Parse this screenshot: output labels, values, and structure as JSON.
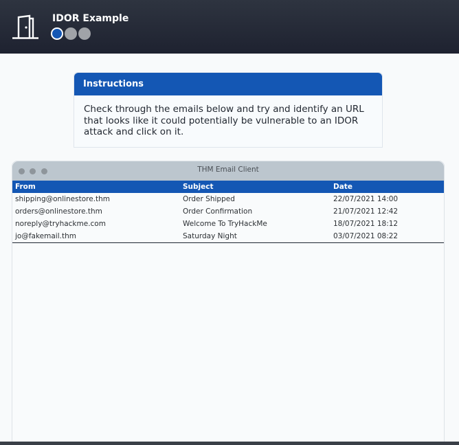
{
  "app": {
    "title": "IDOR Example",
    "icon": "door-icon",
    "steps": [
      {
        "state": "active"
      },
      {
        "state": "inactive"
      },
      {
        "state": "inactive"
      }
    ]
  },
  "instructions": {
    "heading": "Instructions",
    "body": "Check through the emails below and try and identify an URL that looks like it could potentially be vulnerable to an IDOR attack and click on it."
  },
  "email_client": {
    "title": "THM Email Client",
    "columns": [
      "From",
      "Subject",
      "Date"
    ],
    "emails": [
      {
        "from": "shipping@onlinestore.thm",
        "subject": "Order Shipped",
        "date": "22/07/2021 14:00"
      },
      {
        "from": "orders@onlinestore.thm",
        "subject": "Order Confirmation",
        "date": "21/07/2021 12:42"
      },
      {
        "from": "noreply@tryhackme.com",
        "subject": "Welcome To TryHackMe",
        "date": "18/07/2021 18:12"
      },
      {
        "from": "jo@fakemail.thm",
        "subject": "Saturday Night",
        "date": "03/07/2021 08:22"
      }
    ]
  },
  "colors": {
    "accent": "#1457b4",
    "topbar": "#262b38"
  }
}
